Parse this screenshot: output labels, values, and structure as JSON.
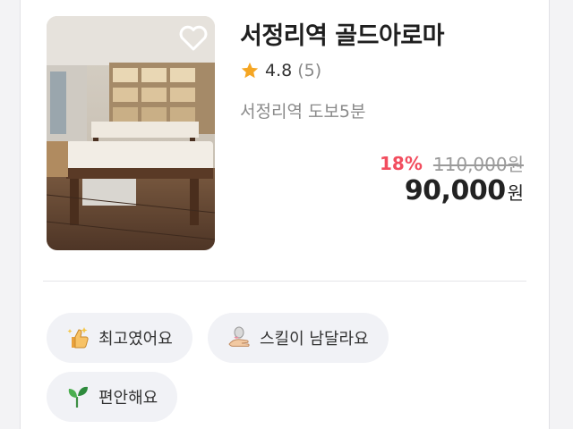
{
  "shop": {
    "name": "서정리역 골드아로마",
    "rating": "4.8",
    "review_count": "(5)",
    "location": "서정리역 도보5분",
    "favorite": false
  },
  "price": {
    "discount": "18%",
    "original": "110,000원",
    "final_amount": "90,000",
    "final_unit": "원"
  },
  "tags": [
    {
      "label": "최고였어요",
      "icon": "thumbs-up-sparkle-icon"
    },
    {
      "label": "스킬이 남달라요",
      "icon": "massage-hand-icon"
    },
    {
      "label": "편안해요",
      "icon": "sprout-icon"
    }
  ],
  "colors": {
    "discount": "#f24d5e",
    "star": "#f5a623",
    "chip_bg": "#f1f2f6"
  }
}
